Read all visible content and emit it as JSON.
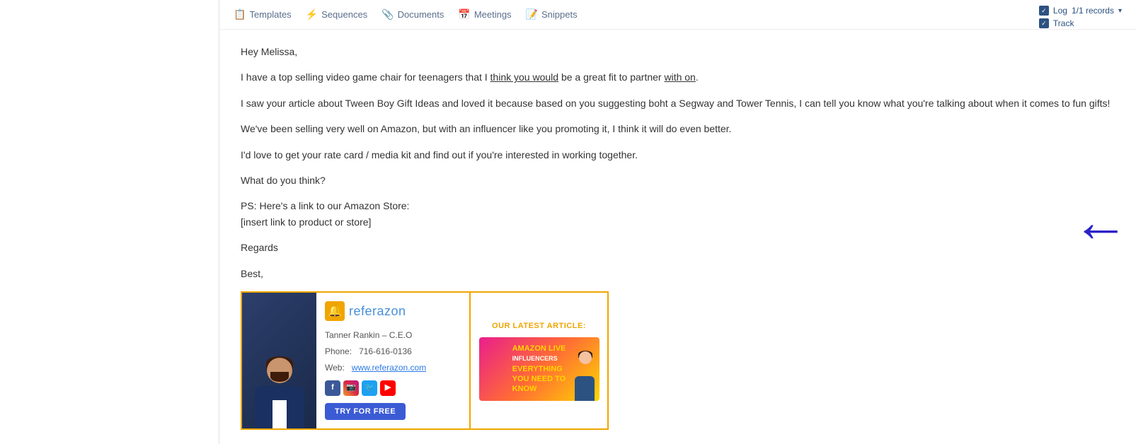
{
  "toolbar": {
    "items": [
      {
        "id": "templates",
        "icon": "📋",
        "label": "Templates"
      },
      {
        "id": "sequences",
        "icon": "⚡",
        "label": "Sequences"
      },
      {
        "id": "documents",
        "icon": "📎",
        "label": "Documents"
      },
      {
        "id": "meetings",
        "icon": "📅",
        "label": "Meetings"
      },
      {
        "id": "snippets",
        "icon": "📝",
        "label": "Snippets"
      }
    ]
  },
  "topright": {
    "log_label": "Log",
    "records_text": "1/1 records",
    "track_label": "Track"
  },
  "email": {
    "greeting": "Hey Melissa,",
    "para1": "I have a top selling video game chair for teenagers that I think you would be a great fit to partner with on.",
    "para1_underline1": "think you would",
    "para1_underline2": "with on",
    "para2": "I saw your article about Tween Boy Gift Ideas and loved it because based on you suggesting boht a Segway and Tower Tennis, I can tell you know what you're talking about when it comes to fun gifts!",
    "para3": "We've been selling very well on Amazon, but with an influencer like you promoting it, I think it will do even better.",
    "para4": "I'd love to get your rate card / media kit and find out if you're interested in working together.",
    "para5": "What do you think?",
    "para6_line1": "PS: Here's a link to our Amazon Store:",
    "para6_line2": "[insert link to product or store]",
    "regards": "Regards",
    "best": "Best,"
  },
  "signature": {
    "logo_icon": "🔔",
    "logo_text": "referazon",
    "name": "Tanner Rankin – C.E.O",
    "phone_label": "Phone:",
    "phone": "716-616-0136",
    "web_label": "Web:",
    "web_url": "www.referazon.com",
    "try_button": "TRY FOR FREE",
    "article_label": "OUR LATEST ARTICLE:",
    "banner_line1": "AMAZON LIVE",
    "banner_line2": "INFLUENCERS",
    "banner_line3": "EVERYTHING",
    "banner_line4": "YOU NEED TO",
    "banner_line5": "KNOW"
  }
}
